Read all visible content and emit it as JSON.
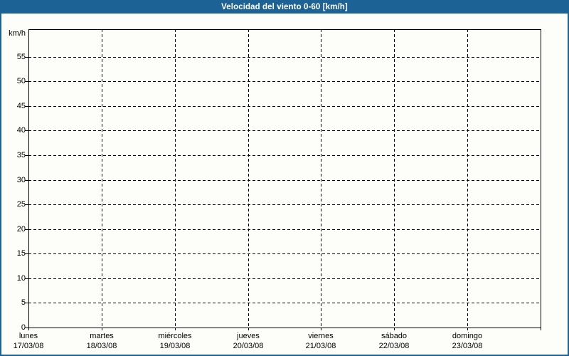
{
  "titlebar": {
    "title": "Velocidad del viento 0-60 [km/h]"
  },
  "colors": {
    "titlebar_bg": "#1d6295",
    "titlebar_text": "#ffffff",
    "frame_border": "#1d6295",
    "background": "#fdfefa",
    "axis": "#000000",
    "gridline": "#000000",
    "label_text": "#000000"
  },
  "chart_data": {
    "type": "line",
    "title": "Velocidad del viento 0-60 [km/h]",
    "ylabel": "km/h",
    "xlabel": "",
    "ylim": [
      0,
      60.6
    ],
    "y_ticks": [
      0,
      5,
      10,
      15,
      20,
      25,
      30,
      35,
      40,
      45,
      50,
      55
    ],
    "x_categories": [
      {
        "day": "lunes",
        "date": "17/03/08"
      },
      {
        "day": "martes",
        "date": "18/03/08"
      },
      {
        "day": "miércoles",
        "date": "19/03/08"
      },
      {
        "day": "jueves",
        "date": "20/03/08"
      },
      {
        "day": "viernes",
        "date": "21/03/08"
      },
      {
        "day": "sábado",
        "date": "22/03/08"
      },
      {
        "day": "domingo",
        "date": "23/03/08"
      }
    ],
    "series": [],
    "grid": "dashed",
    "legend": "none"
  }
}
